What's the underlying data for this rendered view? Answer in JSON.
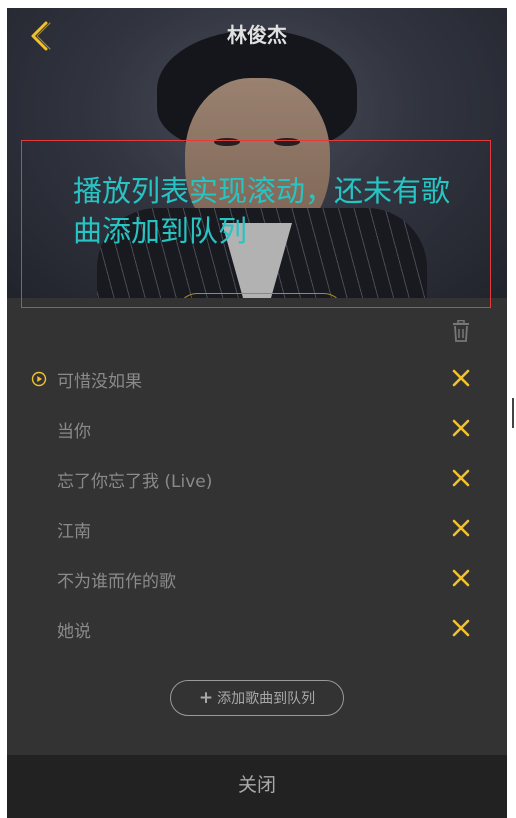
{
  "header": {
    "title": "林俊杰"
  },
  "annotation": {
    "text": "播放列表实现滚动，还未有歌曲添加到队列"
  },
  "playlist": {
    "songs": [
      {
        "title": "可惜没如果",
        "playing": true
      },
      {
        "title": "当你",
        "playing": false
      },
      {
        "title": "忘了你忘了我 (Live)",
        "playing": false
      },
      {
        "title": "江南",
        "playing": false
      },
      {
        "title": "不为谁而作的歌",
        "playing": false
      },
      {
        "title": "她说",
        "playing": false
      }
    ],
    "add_button": {
      "icon": "+",
      "label": "添加歌曲到队列"
    }
  },
  "footer": {
    "close_label": "关闭"
  },
  "colors": {
    "accent": "#f2c12e",
    "annotation_text": "#27c4c4",
    "annotation_border": "#e53a3a",
    "panel_bg": "#333333",
    "footer_bg": "#222222"
  },
  "icons": {
    "back": "chevron-left-icon",
    "trash": "trash-icon",
    "playing": "play-circle-icon",
    "delete": "close-icon"
  }
}
